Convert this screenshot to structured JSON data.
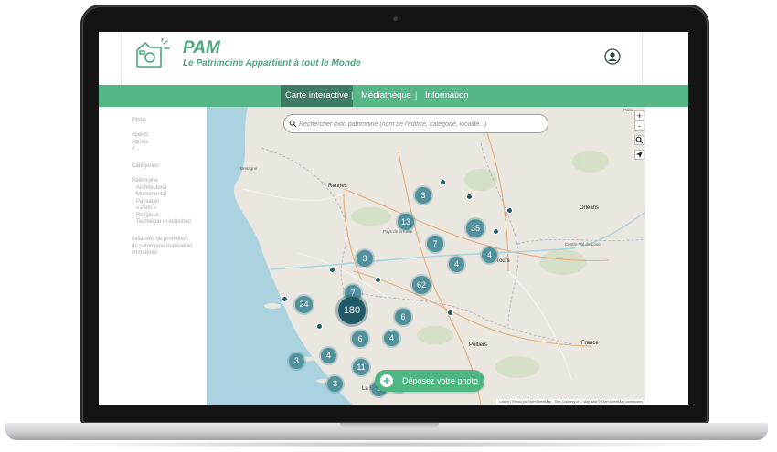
{
  "site": {
    "title": "PAM",
    "tagline": "Le Patrimoine Appartient à tout le Monde"
  },
  "nav": {
    "items": [
      "Carte interactive",
      "Médiathèque",
      "Information"
    ],
    "separator": "|",
    "active_index": 0
  },
  "sidebar": {
    "filters_heading": "Filtres",
    "hashtags": [
      "#ponts",
      "#drone",
      "#..."
    ],
    "categories_heading": "Catégories",
    "heritage_heading": "Patrimoine",
    "heritage_types": [
      "Architectural",
      "Monumental",
      "Paysager",
      "« Petit »",
      "Religieux",
      "Technique et industriel"
    ],
    "initiatives_lines": [
      "Initiatives de promotion",
      "du patrimoine matériel et",
      "immatériel"
    ]
  },
  "search": {
    "placeholder": "Rechercher mon patrimoine (nom de l'édifice, catégorie, localité...)"
  },
  "map": {
    "labels": {
      "paris": "Paris",
      "bretagne": "Bretagne",
      "rennes": "Rennes",
      "pays_de_la_loire": "Pays de la Loire",
      "orleans": "Orléans",
      "centre_val_de_loire": "Centre-Val de Loire",
      "tours": "Tours",
      "poitiers": "Poitiers",
      "france": "France",
      "la_rochelle": "La Ro"
    },
    "controls": {
      "zoom_in": "+",
      "zoom_out": "-"
    },
    "clusters": [
      3,
      13,
      35,
      7,
      4,
      4,
      3,
      62,
      7,
      24,
      180,
      6,
      6,
      4,
      4,
      3,
      11,
      3,
      3,
      3
    ],
    "attribution": "Leaflet | Rendu par OpenStreetMap - Tiles Courtesy of ...  Map data © OpenStreetMap contributors"
  },
  "upload": {
    "label": "Déposez votre photo"
  },
  "colors": {
    "brand_green": "#4aa87a",
    "nav_green": "#57b687",
    "nav_active": "#3f7b63",
    "cluster": "#52909b",
    "cluster_large": "#215a66"
  },
  "icons": {
    "logo": "camera-house-icon",
    "account": "user-circle-icon",
    "search": "magnifier-icon",
    "locate": "locate-arrow-icon",
    "add": "plus-circle-icon"
  }
}
